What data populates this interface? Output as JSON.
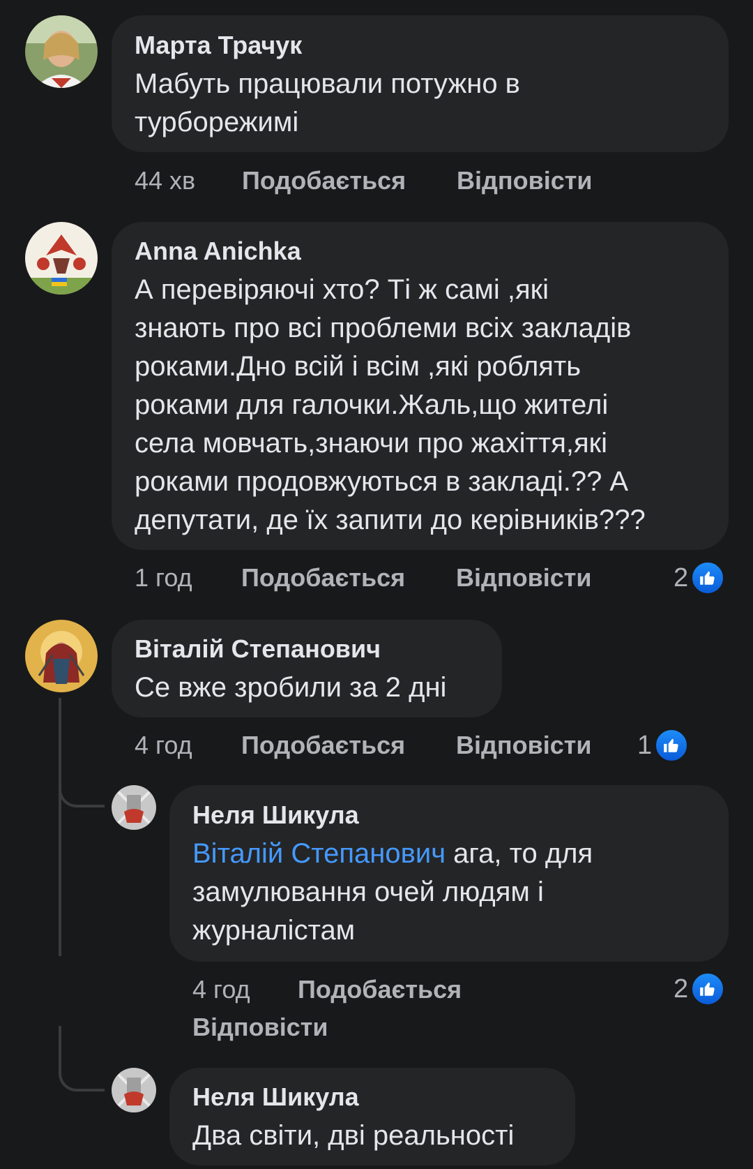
{
  "comments": [
    {
      "author": "Марта Трачук",
      "text": [
        "Мабуть працювали потужно в",
        "турборежимі"
      ],
      "time": "44 хв",
      "like_label": "Подобається",
      "reply_label": "Відповісти"
    },
    {
      "author": "Anna Anichka",
      "text": [
        "А перевіряючі хто? Ті ж самі ,які",
        "знають про всі проблеми всіх закладів",
        "роками.Дно всій і всім ,які роблять",
        "роками для галочки.Жаль,що жителі",
        "села мовчать,знаючи про жахіття,які",
        "роками продовжуються в закладі.?? А",
        "депутати, де їх запити до керівників???"
      ],
      "time": "1 год",
      "like_label": "Подобається",
      "reply_label": "Відповісти",
      "reactions": "2"
    },
    {
      "author": "Віталій Степанович",
      "text": [
        "Се вже зробили за 2 дні"
      ],
      "time": "4 год",
      "like_label": "Подобається",
      "reply_label": "Відповісти",
      "reactions": "1"
    }
  ],
  "replies": [
    {
      "author": "Неля Шикула",
      "mention": "Віталій Степанович",
      "text_first": " ага, то для",
      "text": [
        "замулювання очей людям і",
        "журналістам"
      ],
      "time": "4 год",
      "like_label": "Подобається",
      "reply_label": "Відповісти",
      "reactions": "2"
    },
    {
      "author": "Неля Шикула",
      "text": [
        "Два світи, дві реальності"
      ]
    }
  ],
  "colors": {
    "background": "#18191a",
    "bubble": "#242526",
    "text": "#e4e6eb",
    "secondary": "#b0b3b8",
    "mention": "#4599ff",
    "like": "#1877f2"
  }
}
